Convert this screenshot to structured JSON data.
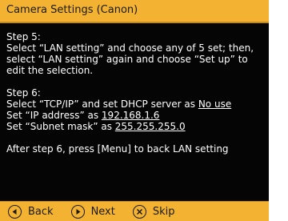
{
  "window": {
    "title": "Camera Settings (Canon)"
  },
  "step5": {
    "heading": "Step 5:",
    "line1": "Select “LAN setting” and choose any of 5 set; then,",
    "line2": "select “LAN setting” again and choose “Set up” to",
    "line3": "edit the selection."
  },
  "step6": {
    "heading": "Step 6:",
    "tcp_prefix": "Select “TCP/IP” and set DHCP server as ",
    "tcp_value": "No use",
    "ip_prefix": "Set “IP address” as ",
    "ip_value": "192.168.1.6",
    "mask_prefix": "Set “Subnet mask” as ",
    "mask_value": "255.255.255.0"
  },
  "note": "After step 6, press [Menu] to back LAN setting",
  "footer": {
    "back_label": "Back",
    "next_label": "Next",
    "skip_label": "Skip",
    "icons": [
      "back-icon",
      "next-icon",
      "skip-icon"
    ]
  },
  "colors": {
    "accent": "#f4b233",
    "panel": "#050505",
    "text": "#ffffff"
  }
}
